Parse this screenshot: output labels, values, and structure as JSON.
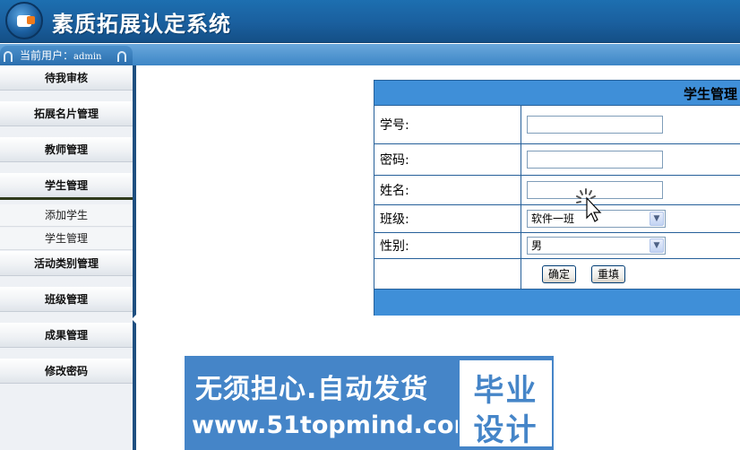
{
  "app": {
    "title": "素质拓展认定系统"
  },
  "user_bar": {
    "label": "当前用户：",
    "username": "admin"
  },
  "sidebar": {
    "menu": [
      {
        "label": "待我审核"
      },
      {
        "label": "拓展名片管理"
      },
      {
        "label": "教师管理"
      },
      {
        "label": "学生管理"
      },
      {
        "label": "活动类别管理"
      },
      {
        "label": "班级管理"
      },
      {
        "label": "成果管理"
      },
      {
        "label": "修改密码"
      }
    ],
    "submenu": [
      {
        "label": "添加学生"
      },
      {
        "label": "学生管理"
      }
    ]
  },
  "form": {
    "title": "学生管理",
    "student_id_label": "学号:",
    "password_label": "密码:",
    "name_label": "姓名:",
    "class_label": "班级:",
    "class_value": "软件一班",
    "gender_label": "性别:",
    "gender_value": "男",
    "submit_label": "确定",
    "reset_label": "重填"
  },
  "banner": {
    "slogan": "无须担心.自动发货",
    "url": "www.51topmind.com",
    "box_line1": "毕业",
    "box_line2": "设计"
  },
  "colors": {
    "header_blue": "#1a5f9e",
    "panel_blue": "#3f8fd8",
    "banner_blue": "#4585c8",
    "border_blue": "#26609a"
  }
}
